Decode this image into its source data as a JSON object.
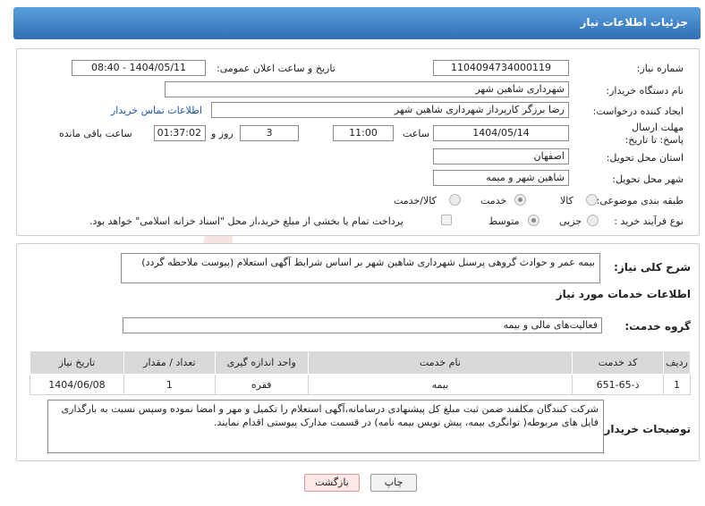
{
  "header": {
    "title": "جزئیات اطلاعات نیاز"
  },
  "watermark": {
    "text": "AriaTender.neT"
  },
  "fields": {
    "need_number_label": "شماره نیاز:",
    "need_number": "1104094734000119",
    "announce_label": "تاریخ و ساعت اعلان عمومی:",
    "announce_value": "1404/05/11 - 08:40",
    "buyer_org_label": "نام دستگاه خریدار:",
    "buyer_org": "شهرداری شاهین شهر",
    "requester_label": "ایجاد کننده درخواست:",
    "requester": "رضا برزگر کارپرداز شهرداری شاهین شهر",
    "buyer_contact_link": "اطلاعات تماس خریدار",
    "deadline_label": "مهلت ارسال پاسخ: تا تاریخ:",
    "deadline_date": "1404/05/14",
    "time_label": "ساعت",
    "deadline_time": "11:00",
    "days_value": "3",
    "days_label": "روز و",
    "remaining_time": "01:37:02",
    "remaining_label": "ساعت باقی مانده",
    "province_label": "استان محل تحویل:",
    "province": "اصفهان",
    "city_label": "شهر محل تحویل:",
    "city": "شاهین شهر و میمه",
    "category_label": "طبقه بندی موضوعی:",
    "category_options": [
      "کالا",
      "خدمت",
      "کالا/خدمت"
    ],
    "category_selected": "خدمت",
    "process_label": "نوع فرآیند خرید :",
    "process_options": [
      "جزیی",
      "متوسط"
    ],
    "process_selected": "متوسط",
    "payment_note": "پرداخت تمام یا بخشی از مبلغ خرید،از محل \"اسناد خزانه اسلامی\" خواهد بود."
  },
  "details": {
    "summary_label": "شرح کلی نیاز:",
    "summary": "بیمه عمر و حوادث گروهی پرسنل شهرداری شاهین شهر بر اساس شرایط آگهی استعلام (پیوست ملاحظه گردد)",
    "services_heading": "اطلاعات خدمات مورد نیاز",
    "service_group_label": "گروه خدمت:",
    "service_group": "فعالیت‌های مالی و بیمه",
    "table": {
      "headers": [
        "ردیف",
        "کد خدمت",
        "نام خدمت",
        "واحد اندازه گیری",
        "تعداد / مقدار",
        "تاریخ نیاز"
      ],
      "rows": [
        [
          "1",
          "ذ-65-651",
          "بیمه",
          "فقره",
          "1",
          "1404/06/08"
        ]
      ]
    },
    "buyer_notes_label": "توضیحات خریدار:",
    "buyer_notes": "شرکت کنندگان مکلفند ضمن ثبت مبلغ کل پیشنهادی درسامانه،آگهی استعلام را  تکمیل و مهر و امضا نموده وسپس نسبت به بارگذاری فایل های مربوطه( توانگری بیمه، پیش نویس بیمه نامه) در قسمت مدارک پیوستی اقدام نمایند."
  },
  "buttons": {
    "print": "چاپ",
    "back": "بازگشت"
  },
  "colors": {
    "header_top": "#5aa0dd",
    "header_bottom": "#2f6fb6",
    "link": "#1a56b0",
    "table_head": "#d9d9d9"
  }
}
